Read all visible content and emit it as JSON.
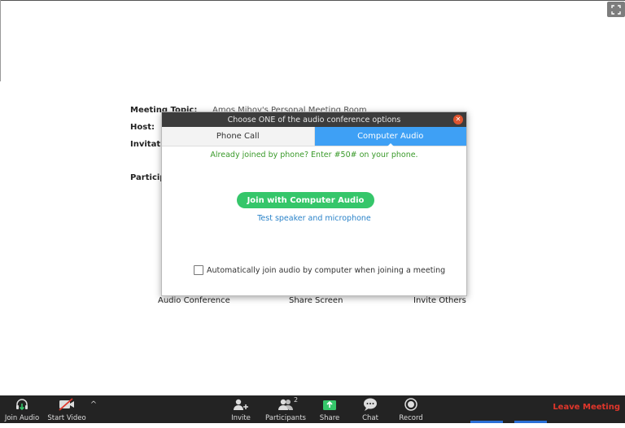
{
  "meeting": {
    "topic_label": "Meeting Topic:",
    "topic_value": "Amos Mihov's Personal Meeting Room",
    "host_label": "Host:",
    "invitation_label": "Invitation",
    "participants_label": "Particip"
  },
  "below_actions": {
    "audio_conference": "Audio Conference",
    "share_screen": "Share Screen",
    "invite_others": "Invite Others"
  },
  "dialog": {
    "title": "Choose ONE of the audio conference options",
    "tabs": [
      {
        "label": "Phone Call",
        "active": false
      },
      {
        "label": "Computer Audio",
        "active": true
      }
    ],
    "hint": "Already joined by phone? Enter #50# on your phone.",
    "join_button": "Join with Computer Audio",
    "test_link": "Test speaker and microphone",
    "auto_join_label": "Automatically join audio by computer when joining a meeting",
    "auto_join_checked": false
  },
  "toolbar": {
    "join_audio": "Join Audio",
    "start_video": "Start Video",
    "invite": "Invite",
    "participants": "Participants",
    "participants_count": "2",
    "share": "Share",
    "chat": "Chat",
    "record": "Record",
    "leave": "Leave Meeting"
  },
  "colors": {
    "accent_blue": "#3ea0f5",
    "join_green": "#35c66a",
    "leave_red": "#e0362b",
    "toolbar_bg": "#232323"
  }
}
